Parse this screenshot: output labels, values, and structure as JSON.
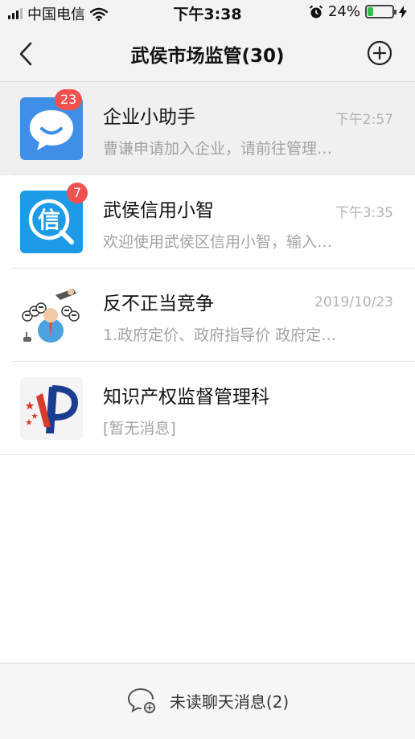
{
  "status_bar": {
    "carrier": "中国电信",
    "time": "下午3:38",
    "battery_percent": "24%",
    "battery_level": 0.24
  },
  "nav": {
    "title": "武侯市场监管(30)",
    "back_icon": "chevron-left-icon",
    "add_icon": "circle-plus-icon"
  },
  "chats": [
    {
      "name": "企业小助手",
      "time": "下午2:57",
      "preview": "曹谦申请加入企业，请前往管理…",
      "badge": "23",
      "avatar_icon": "chat-bubble-icon",
      "avatar_color": "#3f8fe8"
    },
    {
      "name": "武侯信用小智",
      "time": "下午3:35",
      "preview": "欢迎使用武侯区信用小智，输入…",
      "badge": "7",
      "avatar_icon": "credit-magnifier-icon",
      "avatar_color": "#1e9be6"
    },
    {
      "name": "反不正当竞争",
      "time": "2019/10/23",
      "preview": "1.政府定价、政府指导价 政府定…",
      "badge": "",
      "avatar_icon": "cartoon-people-icon"
    },
    {
      "name": "知识产权监督管理科",
      "time": "",
      "preview": "[暂无消息]",
      "badge": "",
      "avatar_icon": "ip-logo-icon"
    }
  ],
  "bottom": {
    "unread_label": "未读聊天消息(2)",
    "icon": "unread-chat-icon"
  },
  "colors": {
    "badge": "#f25151",
    "battery": "#2fc34c",
    "muted_text": "#a3a3a3"
  }
}
